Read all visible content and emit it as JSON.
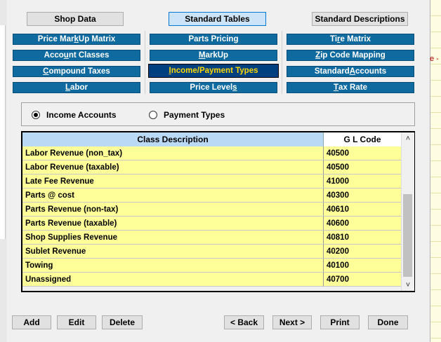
{
  "top_tabs": {
    "shop_data": "Shop Data",
    "standard_tables": "Standard Tables",
    "standard_descriptions": "Standard Descriptions"
  },
  "table_buttons": {
    "col1": [
      {
        "pre": "Price Mar",
        "ul": "k",
        "post": "Up Matrix"
      },
      {
        "pre": "Acco",
        "ul": "u",
        "post": "nt Classes"
      },
      {
        "pre": "",
        "ul": "C",
        "post": "ompound Taxes"
      },
      {
        "pre": "",
        "ul": "L",
        "post": "abor"
      }
    ],
    "col2": [
      {
        "pre": "Parts Pricin",
        "ul": "g",
        "post": ""
      },
      {
        "pre": "",
        "ul": "M",
        "post": "arkUp"
      },
      {
        "pre": "",
        "ul": "I",
        "post": "ncome/Payment Types"
      },
      {
        "pre": "Price Level",
        "ul": "s",
        "post": ""
      }
    ],
    "col3": [
      {
        "pre": "Ti",
        "ul": "r",
        "post": "e Matrix"
      },
      {
        "pre": "",
        "ul": "Z",
        "post": "ip Code Mapping"
      },
      {
        "pre": "Standard ",
        "ul": "A",
        "post": "ccounts"
      },
      {
        "pre": "",
        "ul": "T",
        "post": "ax Rate"
      }
    ]
  },
  "radio": {
    "income_accounts": "Income Accounts",
    "payment_types": "Payment Types",
    "selected": "income_accounts"
  },
  "grid": {
    "headers": {
      "class_description": "Class Description",
      "gl_code": "G L Code"
    },
    "rows": [
      {
        "desc": "Labor Revenue (non_tax)",
        "gl": "40500"
      },
      {
        "desc": "Labor Revenue (taxable)",
        "gl": "40500"
      },
      {
        "desc": "Late Fee Revenue",
        "gl": "41000"
      },
      {
        "desc": "Parts @ cost",
        "gl": "40300"
      },
      {
        "desc": "Parts Revenue (non-tax)",
        "gl": "40610"
      },
      {
        "desc": "Parts Revenue (taxable)",
        "gl": "40600"
      },
      {
        "desc": "Shop Supplies Revenue",
        "gl": "40810"
      },
      {
        "desc": "Sublet Revenue",
        "gl": "40200"
      },
      {
        "desc": "Towing",
        "gl": "40100"
      },
      {
        "desc": "Unassigned",
        "gl": "40700"
      }
    ],
    "scroll_up_icon": "chevron-up-icon",
    "scroll_down_icon": "chevron-down-icon"
  },
  "bottom_buttons": {
    "add": "Add",
    "edit": "Edit",
    "delete": "Delete",
    "back": "< Back",
    "next": "Next >",
    "print": "Print",
    "done": "Done"
  },
  "right_edge_text": "e -",
  "colors": {
    "blue_button": "#0f6aa0",
    "selected_button": "#003f80",
    "selected_text": "#ffd800",
    "row_yellow": "#ffff99",
    "header_blue": "#b9d9f5"
  }
}
